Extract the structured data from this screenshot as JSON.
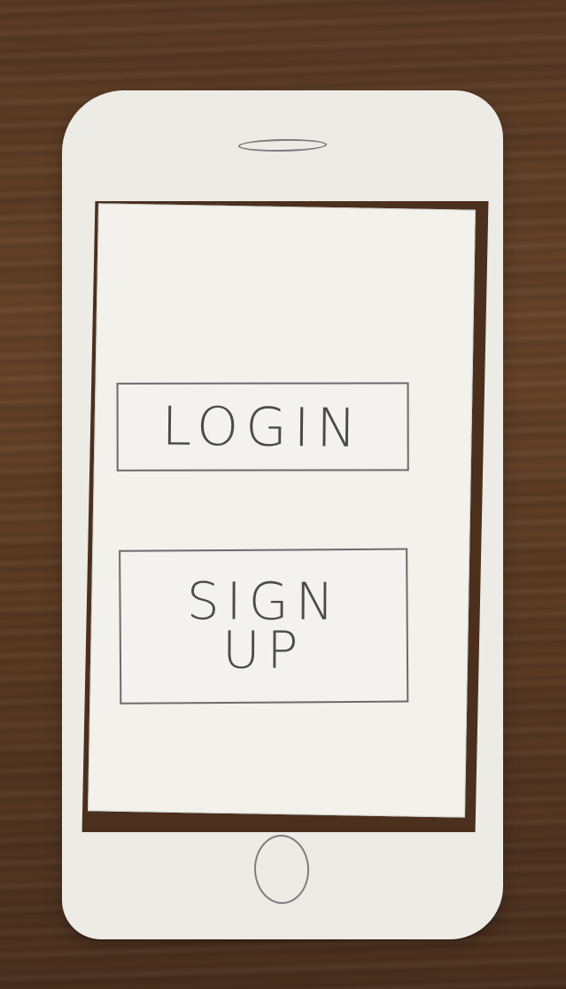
{
  "scene": {
    "screen": {
      "buttons": {
        "login": {
          "label": "LOGIN"
        },
        "signup": {
          "label": "SIGN\nUP"
        }
      }
    }
  }
}
